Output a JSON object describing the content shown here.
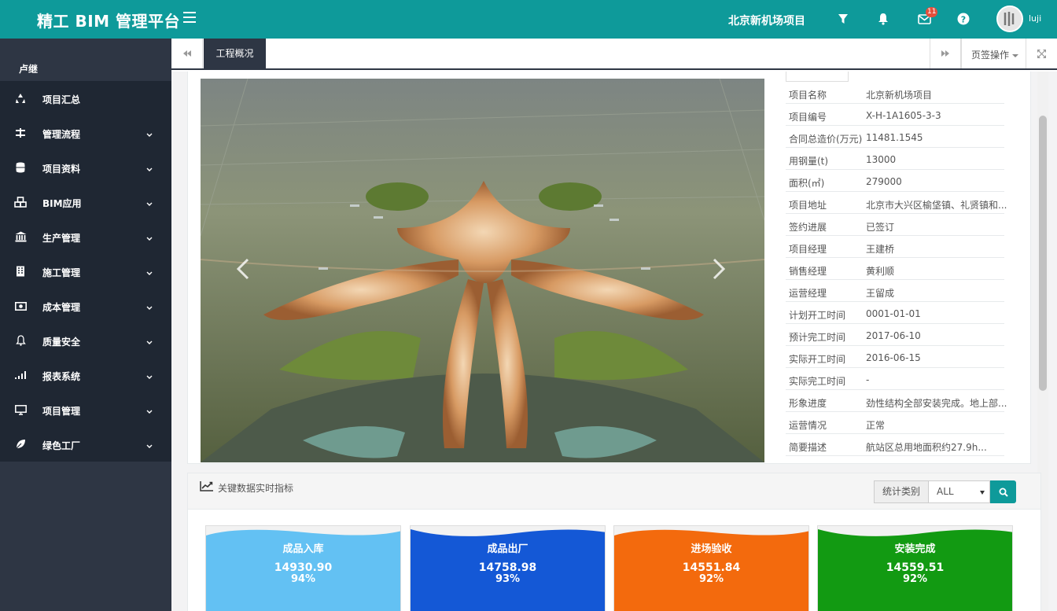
{
  "header": {
    "brand": "精工 BIM 管理平台",
    "project": "北京新机场项目",
    "badge_count": "11",
    "username": "luji",
    "icons": [
      "menu-icon",
      "filter-icon",
      "bell-icon",
      "mail-icon",
      "help-icon"
    ]
  },
  "sidebar": {
    "user": "卢继",
    "items": [
      {
        "label": "项目汇总",
        "icon": "recycle-icon"
      },
      {
        "label": "管理流程",
        "icon": "sliders-icon"
      },
      {
        "label": "项目资料",
        "icon": "database-icon"
      },
      {
        "label": "BIM应用",
        "icon": "cubes-icon"
      },
      {
        "label": "生产管理",
        "icon": "bank-icon"
      },
      {
        "label": "施工管理",
        "icon": "building-icon"
      },
      {
        "label": "成本管理",
        "icon": "money-icon"
      },
      {
        "label": "质量安全",
        "icon": "bell-icon"
      },
      {
        "label": "报表系统",
        "icon": "signal-icon"
      },
      {
        "label": "项目管理",
        "icon": "desktop-icon"
      },
      {
        "label": "绿色工厂",
        "icon": "leaf-icon"
      }
    ]
  },
  "tabs": {
    "active": "工程概况",
    "ops_label": "页签操作"
  },
  "info": [
    {
      "k": "项目名称",
      "v": "北京新机场项目"
    },
    {
      "k": "项目编号",
      "v": "X-H-1A1605-3-3"
    },
    {
      "k": "合同总造价(万元)",
      "v": "11481.1545"
    },
    {
      "k": "用钢量(t)",
      "v": "13000"
    },
    {
      "k": "面积(㎡)",
      "v": "279000"
    },
    {
      "k": "项目地址",
      "v": "北京市大兴区榆垡镇、礼贤镇和..."
    },
    {
      "k": "签约进展",
      "v": "已签订"
    },
    {
      "k": "项目经理",
      "v": "王建桥"
    },
    {
      "k": "销售经理",
      "v": "黄利顺"
    },
    {
      "k": "运营经理",
      "v": "王留成"
    },
    {
      "k": "计划开工时间",
      "v": "0001-01-01"
    },
    {
      "k": "预计完工时间",
      "v": "2017-06-10"
    },
    {
      "k": "实际开工时间",
      "v": "2016-06-15"
    },
    {
      "k": "实际完工时间",
      "v": "-"
    },
    {
      "k": "形象进度",
      "v": "劲性结构全部安装完成。地上部..."
    },
    {
      "k": "运营情况",
      "v": "正常"
    },
    {
      "k": "简要描述",
      "v": "航站区总用地面积约27.9h..."
    }
  ],
  "kpi": {
    "title": "关键数据实时指标",
    "filter_label": "统计类别",
    "filter_value": "ALL",
    "cards": [
      {
        "name": "成品入库",
        "value": "14930.90",
        "percent": "94%",
        "color": "#63c1f3"
      },
      {
        "name": "成品出厂",
        "value": "14758.98",
        "percent": "93%",
        "color": "#1458d6"
      },
      {
        "name": "进场验收",
        "value": "14551.84",
        "percent": "92%",
        "color": "#f36a0d"
      },
      {
        "name": "安装完成",
        "value": "14559.51",
        "percent": "92%",
        "color": "#129a12"
      }
    ]
  }
}
